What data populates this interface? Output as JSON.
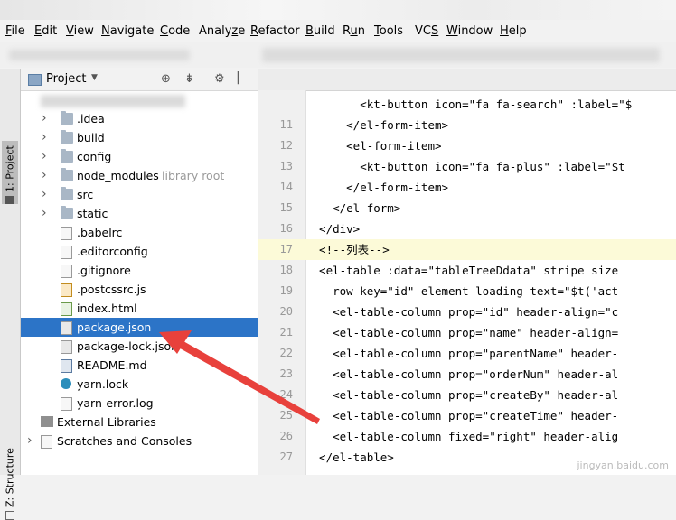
{
  "menu": [
    "File",
    "Edit",
    "View",
    "Navigate",
    "Code",
    "Analyze",
    "Refactor",
    "Build",
    "Run",
    "Tools",
    "VCS",
    "Window",
    "Help"
  ],
  "menu_mnemonics": [
    "F",
    "E",
    "V",
    "N",
    "C",
    "z",
    "R",
    "B",
    "u",
    "T",
    "S",
    "W",
    "H"
  ],
  "tool_stripe": {
    "project_tab": "1: Project",
    "structure_tab": "Z: Structure"
  },
  "project_panel": {
    "title": "Project",
    "tree": [
      {
        "label": ".idea",
        "type": "folder",
        "expandable": true
      },
      {
        "label": "build",
        "type": "folder",
        "expandable": true
      },
      {
        "label": "config",
        "type": "folder",
        "expandable": true
      },
      {
        "label": "node_modules",
        "type": "folder",
        "expandable": true,
        "extra": "library root"
      },
      {
        "label": "src",
        "type": "folder",
        "expandable": true
      },
      {
        "label": "static",
        "type": "folder",
        "expandable": true
      },
      {
        "label": ".babelrc",
        "type": "file"
      },
      {
        "label": ".editorconfig",
        "type": "file"
      },
      {
        "label": ".gitignore",
        "type": "file"
      },
      {
        "label": ".postcssrc.js",
        "type": "js"
      },
      {
        "label": "index.html",
        "type": "html"
      },
      {
        "label": "package.json",
        "type": "json",
        "selected": true
      },
      {
        "label": "package-lock.json",
        "type": "json"
      },
      {
        "label": "README.md",
        "type": "md"
      },
      {
        "label": "yarn.lock",
        "type": "yarn"
      },
      {
        "label": "yarn-error.log",
        "type": "file"
      },
      {
        "label": "External Libraries",
        "type": "libs",
        "root": true
      },
      {
        "label": "Scratches and Consoles",
        "type": "scratch",
        "root": true,
        "expandable": true
      }
    ]
  },
  "editor": {
    "lines": [
      {
        "num": "",
        "code": "        <kt-button icon=\"fa fa-search\" :label=\"$"
      },
      {
        "num": "11",
        "code": "      </el-form-item>"
      },
      {
        "num": "12",
        "code": "      <el-form-item>"
      },
      {
        "num": "13",
        "code": "        <kt-button icon=\"fa fa-plus\" :label=\"$t"
      },
      {
        "num": "14",
        "code": "      </el-form-item>"
      },
      {
        "num": "15",
        "code": "    </el-form>"
      },
      {
        "num": "16",
        "code": "  </div>"
      },
      {
        "num": "17",
        "code": "  <!--列表-->",
        "highlight": true
      },
      {
        "num": "18",
        "code": "  <el-table :data=\"tableTreeDdata\" stripe size"
      },
      {
        "num": "19",
        "code": "    row-key=\"id\" element-loading-text=\"$t('act"
      },
      {
        "num": "20",
        "code": "    <el-table-column prop=\"id\" header-align=\"c"
      },
      {
        "num": "21",
        "code": "    <el-table-column prop=\"name\" header-align="
      },
      {
        "num": "22",
        "code": "    <el-table-column prop=\"parentName\" header-"
      },
      {
        "num": "23",
        "code": "    <el-table-column prop=\"orderNum\" header-al"
      },
      {
        "num": "24",
        "code": "    <el-table-column prop=\"createBy\" header-al"
      },
      {
        "num": "25",
        "code": "    <el-table-column prop=\"createTime\" header-"
      },
      {
        "num": "26",
        "code": "    <el-table-column fixed=\"right\" header-alig"
      },
      {
        "num": "27",
        "code": "  </el-table>"
      }
    ]
  },
  "watermark": "jingyan.baidu.com",
  "colors": {
    "selection": "#2c74c7",
    "annotation_arrow": "#e8413c",
    "highlight_line": "#fcfad8"
  }
}
